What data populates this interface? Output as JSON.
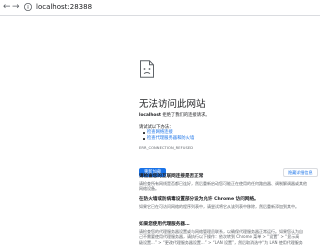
{
  "browser": {
    "url": "localhost:28388",
    "back_icon": "back-arrow-icon",
    "forward_icon": "forward-arrow-icon",
    "info_icon": "info-icon"
  },
  "error_page": {
    "icon": "sad-page-icon",
    "title": "无法访问此网站",
    "detail_host": "localhost",
    "detail_rest": " 拒绝了我们的连接请求。",
    "suggest_heading": "请试试以下办法：",
    "suggestions": [
      "检查网络连接",
      "检查代理服务器和防火墙"
    ],
    "error_code": "ERR_CONNECTION_REFUSED",
    "reload_label": "重新加载",
    "details_label": "隐藏详细信息"
  },
  "details": {
    "sections": [
      {
        "heading": "请检查您的互联网连接是否正常",
        "lines": [
          "请检查所有网线是否都已连好，然后重新启动您可能正在使用的任何路由器、调制解调器或其他",
          "网络设备。"
        ]
      },
      {
        "heading": "在防火墙或防病毒设置部分设为允许 Chrome 访问网络。",
        "lines": [
          "如果它已在可访问网络的程序列表中，请尝试将它从该列表中移除，然后重新添加到其中。"
        ]
      },
      {
        "heading": "如果您使用代理服务器…",
        "lines": [
          "请检查您的代理服务器设置或与网络管理员联系，以确保代理服务器正常运行。如果您认为自",
          "己不需要使用代理服务器，请执行以下操作：依次转到 Chrome 菜单 > “设置” > “显示高",
          "级设置...” > “更改代理服务器设置...” > “LAN 设置”，然后取消选中“为 LAN 使用代理服务"
        ]
      }
    ]
  },
  "colors": {
    "accent": "#1a73e8",
    "text": "#202124",
    "muted": "#5f6368"
  }
}
